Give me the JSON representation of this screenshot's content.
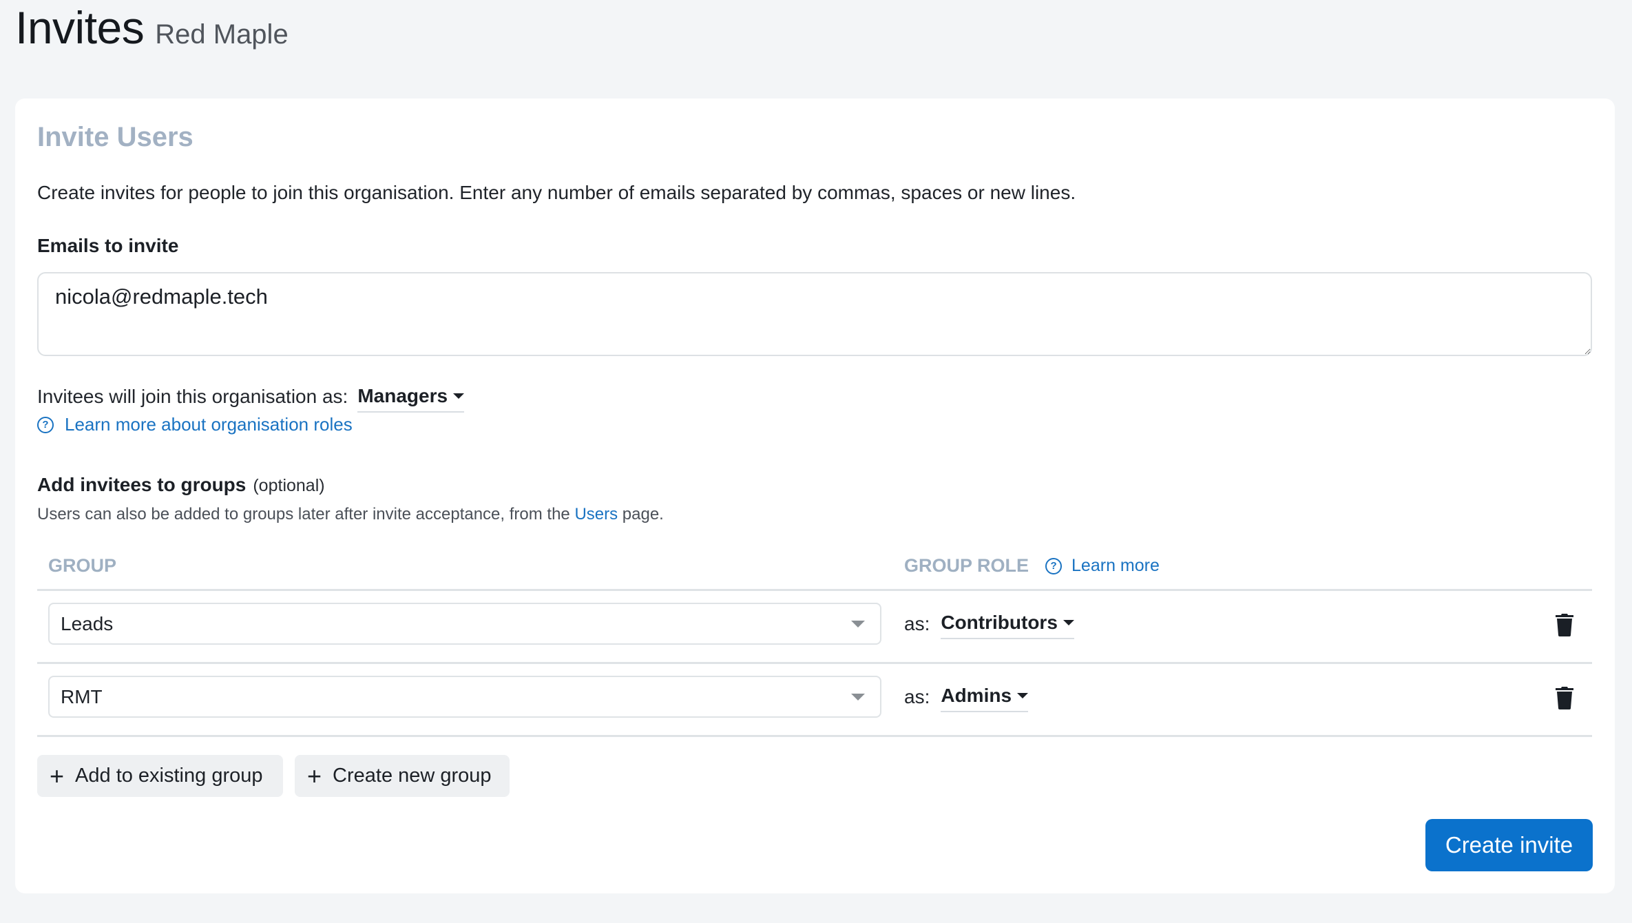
{
  "header": {
    "title": "Invites",
    "org_name": "Red Maple"
  },
  "card": {
    "title": "Invite Users",
    "intro": "Create invites for people to join this organisation. Enter any number of emails separated by commas, spaces or new lines.",
    "emails_label": "Emails to invite",
    "emails_value": "nicola@redmaple.tech",
    "join_label": "Invitees will join this organisation as:",
    "org_role": "Managers",
    "learn_roles_link": "Learn more about organisation roles",
    "groups": {
      "title": "Add invitees to groups",
      "optional": "(optional)",
      "sub_prefix": "Users can also be added to groups later after invite acceptance, from the ",
      "sub_link": "Users",
      "sub_suffix": " page.",
      "col_group": "GROUP",
      "col_role": "GROUP ROLE",
      "col_role_learn": "Learn more",
      "as_label": "as:",
      "rows": [
        {
          "group": "Leads",
          "role": "Contributors"
        },
        {
          "group": "RMT",
          "role": "Admins"
        }
      ],
      "add_existing": "Add to existing group",
      "create_new": "Create new group"
    },
    "submit": "Create invite"
  },
  "icons": {
    "help": "question-circle-icon",
    "delete": "trash-icon",
    "add": "plus-icon",
    "caret": "caret-down-icon"
  },
  "colors": {
    "primary": "#0b72cc",
    "link": "#1a73c2",
    "muted_heading": "#a2b1c3",
    "background": "#f3f5f7"
  }
}
